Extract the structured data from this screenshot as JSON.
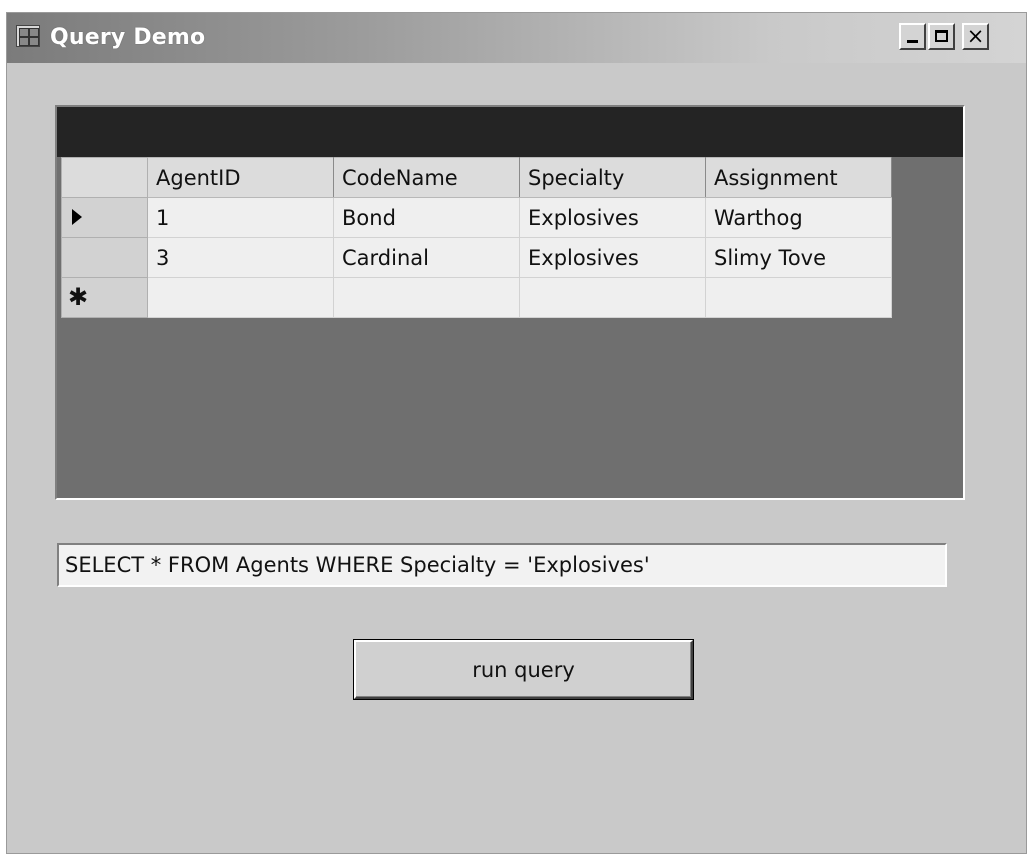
{
  "window": {
    "title": "Query Demo",
    "close_glyph": "×"
  },
  "grid": {
    "columns": [
      "AgentID",
      "CodeName",
      "Specialty",
      "Assignment"
    ],
    "rows": [
      {
        "AgentID": "1",
        "CodeName": "Bond",
        "Specialty": "Explosives",
        "Assignment": "Warthog"
      },
      {
        "AgentID": "3",
        "CodeName": "Cardinal",
        "Specialty": "Explosives",
        "Assignment": "Slimy Tove"
      }
    ],
    "new_row_marker": "✱"
  },
  "query": {
    "value": "SELECT * FROM Agents WHERE Specialty = 'Explosives'"
  },
  "run_button": {
    "label": "run query"
  }
}
